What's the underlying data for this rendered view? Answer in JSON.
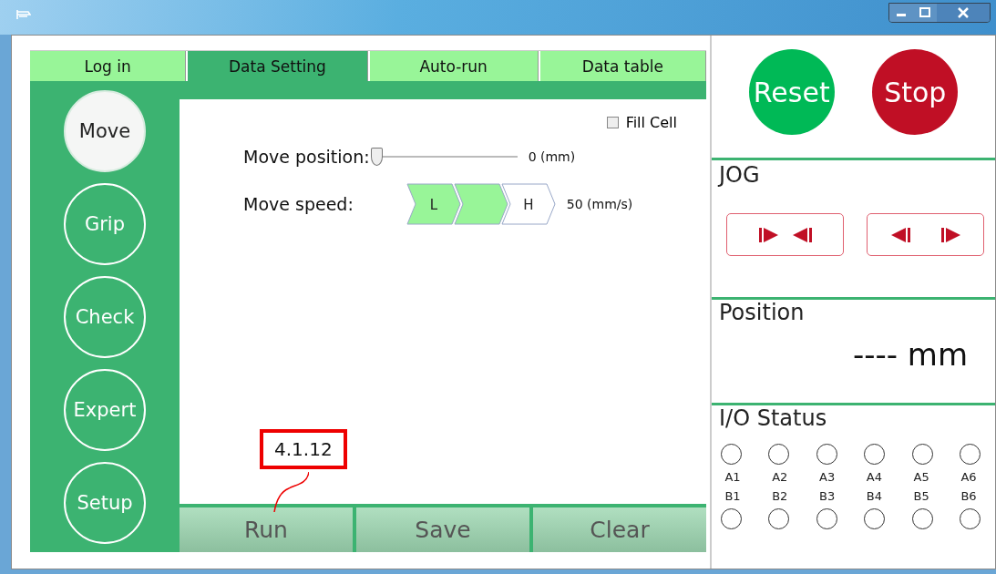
{
  "tabs": [
    {
      "label": "Log in",
      "selected": false
    },
    {
      "label": "Data Setting",
      "selected": true
    },
    {
      "label": "Auto-run",
      "selected": false
    },
    {
      "label": "Data table",
      "selected": false
    }
  ],
  "side_buttons": [
    {
      "label": "Move",
      "selected": true
    },
    {
      "label": "Grip",
      "selected": false
    },
    {
      "label": "Check",
      "selected": false
    },
    {
      "label": "Expert",
      "selected": false
    },
    {
      "label": "Setup",
      "selected": false
    }
  ],
  "fill_cell": {
    "label": "Fill Cell",
    "checked": false
  },
  "move_position": {
    "label": "Move position:",
    "level": 0,
    "reading": "0 (mm)"
  },
  "move_speed": {
    "label": "Move speed:",
    "reading": "50 (mm/s)",
    "segments": [
      {
        "label": "L",
        "on": true
      },
      {
        "on": true
      },
      {
        "label": "H",
        "on": false
      }
    ]
  },
  "actions": [
    "Run",
    "Save",
    "Clear"
  ],
  "callout": "4.1.12",
  "reset": "Reset",
  "stop": "Stop",
  "jog": {
    "title": "JOG"
  },
  "position": {
    "title": "Position",
    "value": "---- mm"
  },
  "io_status": {
    "title": "I/O Status",
    "a": [
      {
        "label": "A1",
        "on": false
      },
      {
        "label": "A2",
        "on": false
      },
      {
        "label": "A3",
        "on": false
      },
      {
        "label": "A4",
        "on": false
      },
      {
        "label": "A5",
        "on": false
      },
      {
        "label": "A6",
        "on": false
      }
    ],
    "b": [
      {
        "label": "B1",
        "on": false
      },
      {
        "label": "B2",
        "on": false
      },
      {
        "label": "B3",
        "on": false
      },
      {
        "label": "B4",
        "on": false
      },
      {
        "label": "B5",
        "on": false
      },
      {
        "label": "B6",
        "on": false
      }
    ]
  }
}
